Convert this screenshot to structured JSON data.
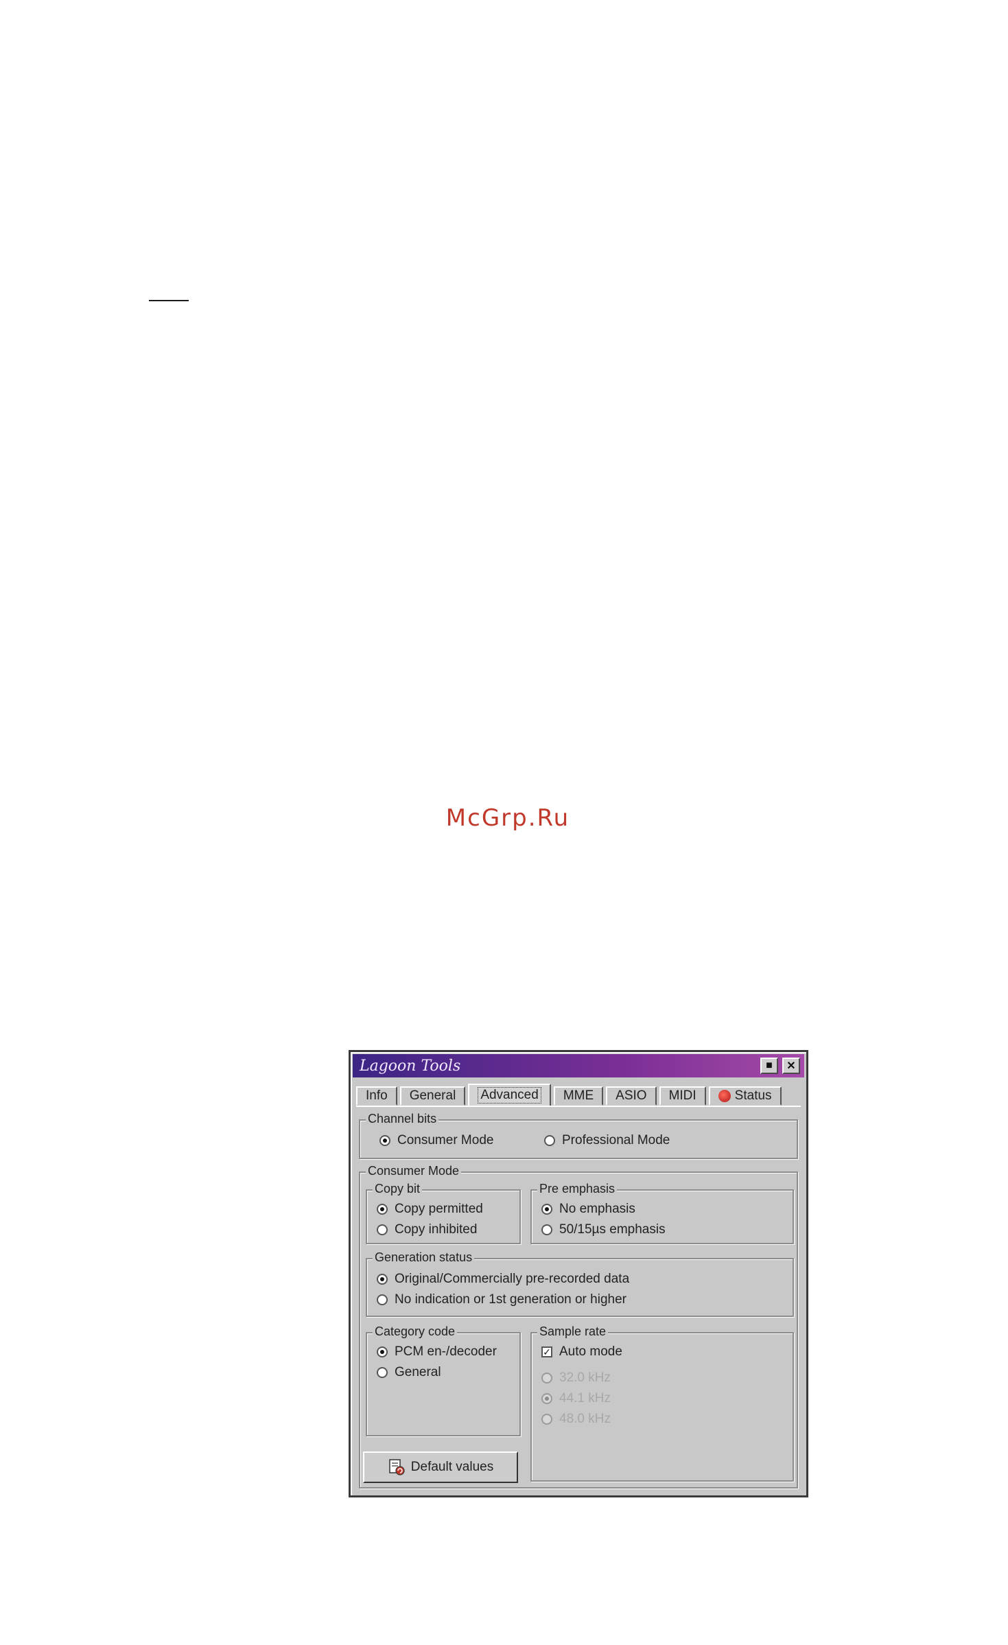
{
  "watermark": "McGrp.Ru",
  "window": {
    "title": "Lagoon Tools",
    "pin_glyph": "■",
    "close_glyph": "✕"
  },
  "tabs": [
    {
      "label": "Info"
    },
    {
      "label": "General"
    },
    {
      "label": "Advanced",
      "active": true
    },
    {
      "label": "MME"
    },
    {
      "label": "ASIO"
    },
    {
      "label": "MIDI"
    },
    {
      "label": "Status"
    }
  ],
  "channel_bits": {
    "legend": "Channel bits",
    "options": [
      {
        "label": "Consumer Mode",
        "selected": true
      },
      {
        "label": "Professional Mode",
        "selected": false
      }
    ]
  },
  "consumer_mode": {
    "legend": "Consumer Mode",
    "copy_bit": {
      "legend": "Copy bit",
      "options": [
        {
          "label": "Copy permitted",
          "selected": true
        },
        {
          "label": "Copy inhibited",
          "selected": false
        }
      ]
    },
    "pre_emphasis": {
      "legend": "Pre emphasis",
      "options": [
        {
          "label": "No emphasis",
          "selected": true
        },
        {
          "label": "50/15µs emphasis",
          "selected": false
        }
      ]
    },
    "generation_status": {
      "legend": "Generation status",
      "options": [
        {
          "label": "Original/Commercially pre-recorded data",
          "selected": true
        },
        {
          "label": "No indication or  1st generation or higher",
          "selected": false
        }
      ]
    },
    "category_code": {
      "legend": "Category code",
      "options": [
        {
          "label": "PCM en-/decoder",
          "selected": true
        },
        {
          "label": "General",
          "selected": false
        }
      ]
    },
    "sample_rate": {
      "legend": "Sample rate",
      "auto_mode": {
        "label": "Auto mode",
        "checked": true,
        "glyph": "✓"
      },
      "options": [
        {
          "label": "32.0 kHz",
          "selected": false
        },
        {
          "label": "44.1 kHz",
          "selected": true
        },
        {
          "label": "48.0 kHz",
          "selected": false
        }
      ]
    }
  },
  "default_button": {
    "label": "Default values"
  }
}
